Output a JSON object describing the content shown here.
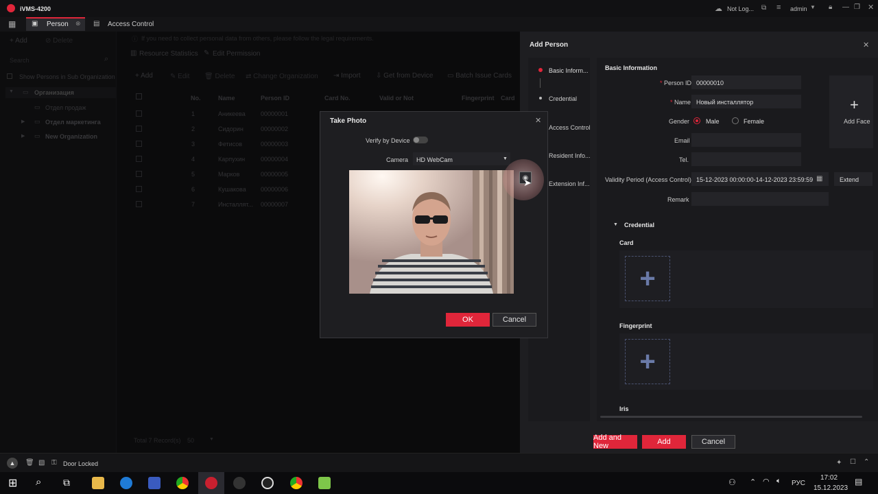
{
  "app": {
    "title": "iVMS-4200",
    "network_status": "Not Log...",
    "user": "admin"
  },
  "tabs": {
    "person": "Person",
    "access_control": "Access Control"
  },
  "left_panel": {
    "add": "Add",
    "delete": "Delete",
    "search_placeholder": "Search",
    "show_sub_org": "Show Persons in Sub Organization",
    "tree": [
      "Организация",
      "Отдел продаж",
      "Отдел маркетинга",
      "New Organization"
    ]
  },
  "main": {
    "notice": "If you need to collect personal data from others, please follow the legal requirements.",
    "resource_statistics": "Resource Statistics",
    "edit_permission": "Edit Permission",
    "toolbar": [
      "Add",
      "Edit",
      "Delete",
      "Change Organization",
      "Import",
      "Get from Device",
      "Batch Issue Cards"
    ],
    "columns": [
      "No.",
      "Name",
      "Person ID",
      "Card No.",
      "Valid or Not",
      "Fingerprint",
      "Card"
    ],
    "rows": [
      [
        "1",
        "Аникеева",
        "00000001"
      ],
      [
        "2",
        "Сидорин",
        "00000002"
      ],
      [
        "3",
        "Фетисов",
        "00000003"
      ],
      [
        "4",
        "Карпухин",
        "00000004"
      ],
      [
        "5",
        "Марков",
        "00000005"
      ],
      [
        "6",
        "Кушакова",
        "00000006"
      ],
      [
        "7",
        "Инсталлят...",
        "00000007"
      ]
    ],
    "total": "Total 7 Record(s)",
    "per_page": "50"
  },
  "add_person": {
    "title": "Add Person",
    "nav": [
      "Basic Inform...",
      "Credential",
      "Access Control",
      "Resident Info...",
      "Extension Inf..."
    ],
    "section_basic": "Basic Information",
    "labels": {
      "person_id": "Person ID",
      "name": "Name",
      "gender": "Gender",
      "email": "Email",
      "tel": "Tel.",
      "validity": "Validity Period (Access Control)",
      "remark": "Remark"
    },
    "values": {
      "person_id": "00000010",
      "name": "Новый инсталлятор",
      "male": "Male",
      "female": "Female",
      "validity": "15-12-2023 00:00:00-14-12-2023 23:59:59"
    },
    "extend": "Extend",
    "add_face": "Add Face",
    "section_credential": "Credential",
    "card": "Card",
    "fingerprint": "Fingerprint",
    "iris": "Iris",
    "buttons": {
      "add_and_new": "Add and New",
      "add": "Add",
      "cancel": "Cancel"
    }
  },
  "take_photo": {
    "title": "Take Photo",
    "verify_label": "Verify by Device",
    "camera_label": "Camera",
    "camera_value": "HD WebCam",
    "ok": "OK",
    "cancel": "Cancel"
  },
  "status_bar": {
    "door_locked": "Door Locked"
  },
  "taskbar": {
    "lang": "РУС",
    "time": "17:02",
    "date": "15.12.2023"
  },
  "colors": {
    "accent": "#e0263a",
    "panel": "#1e1e21"
  }
}
